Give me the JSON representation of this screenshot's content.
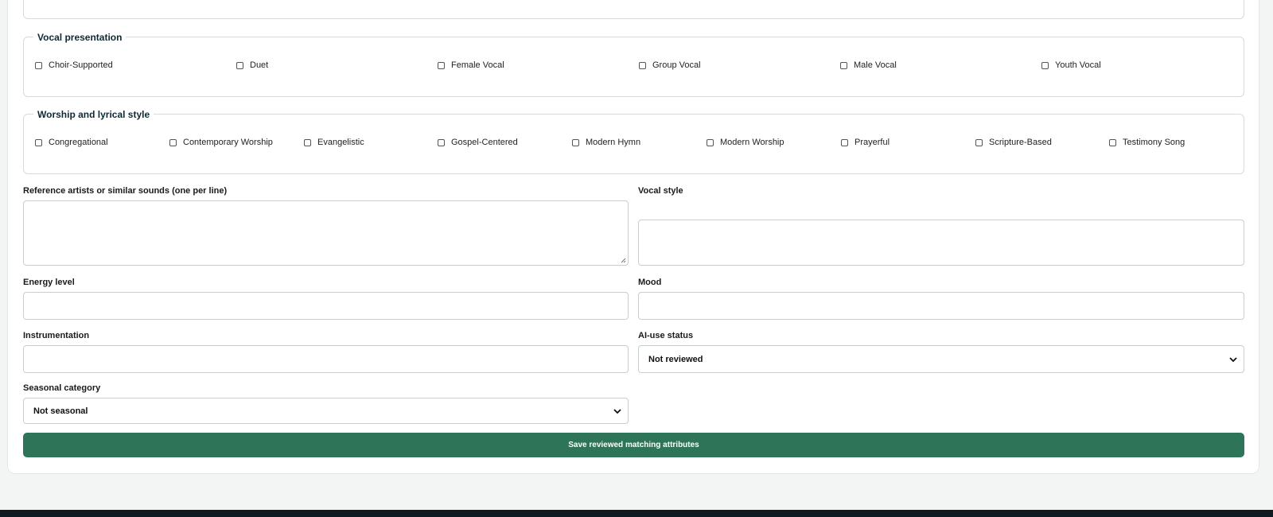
{
  "vocal_presentation": {
    "legend": "Vocal presentation",
    "options": [
      "Choir-Supported",
      "Duet",
      "Female Vocal",
      "Group Vocal",
      "Male Vocal",
      "Youth Vocal"
    ]
  },
  "worship_style": {
    "legend": "Worship and lyrical style",
    "options": [
      "Congregational",
      "Contemporary Worship",
      "Evangelistic",
      "Gospel-Centered",
      "Modern Hymn",
      "Modern Worship",
      "Prayerful",
      "Scripture-Based",
      "Testimony Song"
    ]
  },
  "fields": {
    "reference_artists_label": "Reference artists or similar sounds (one per line)",
    "reference_artists_value": "",
    "vocal_style_label": "Vocal style",
    "vocal_style_value": "",
    "energy_level_label": "Energy level",
    "energy_level_value": "",
    "mood_label": "Mood",
    "mood_value": "",
    "instrumentation_label": "Instrumentation",
    "instrumentation_value": "",
    "ai_use_status_label": "AI-use status",
    "ai_use_status_value": "Not reviewed",
    "seasonal_category_label": "Seasonal category",
    "seasonal_category_value": "Not seasonal"
  },
  "save_button_label": "Save reviewed matching attributes",
  "colors": {
    "primary_button": "#2e7459",
    "legend_text": "#0d2a33",
    "footer": "#0f1a20"
  }
}
